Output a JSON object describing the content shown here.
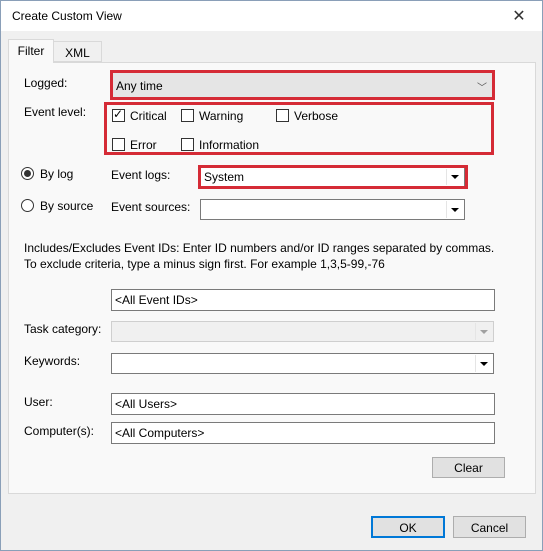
{
  "window": {
    "title": "Create Custom View",
    "close_glyph": "✕"
  },
  "tabs": [
    {
      "label": "Filter",
      "active": true
    },
    {
      "label": "XML",
      "active": false
    }
  ],
  "filter": {
    "logged": {
      "label": "Logged:",
      "value": "Any time"
    },
    "event_level": {
      "label": "Event level:",
      "options": [
        {
          "label": "Critical",
          "checked": true
        },
        {
          "label": "Warning",
          "checked": false
        },
        {
          "label": "Verbose",
          "checked": false
        },
        {
          "label": "Error",
          "checked": false
        },
        {
          "label": "Information",
          "checked": false
        }
      ]
    },
    "by_log": {
      "label": "By log",
      "selected": true
    },
    "by_source": {
      "label": "By source",
      "selected": false
    },
    "event_logs": {
      "label": "Event logs:",
      "value": "System"
    },
    "event_sources": {
      "label": "Event sources:",
      "value": ""
    },
    "description": "Includes/Excludes Event IDs: Enter ID numbers and/or ID ranges separated by commas. To exclude criteria, type a minus sign first. For example 1,3,5-99,-76",
    "event_ids": {
      "value": "<All Event IDs>"
    },
    "task_category": {
      "label": "Task category:",
      "value": ""
    },
    "keywords": {
      "label": "Keywords:",
      "value": ""
    },
    "user": {
      "label": "User:",
      "value": "<All Users>"
    },
    "computers": {
      "label": "Computer(s):",
      "value": "<All Computers>"
    },
    "clear_label": "Clear"
  },
  "footer": {
    "ok_label": "OK",
    "cancel_label": "Cancel"
  },
  "colors": {
    "highlight": "#d52b36",
    "default_button_border": "#0078d7"
  },
  "icons": {
    "close": "close-icon",
    "check": "checkmark-icon",
    "dropdown": "chevron-down-icon"
  }
}
